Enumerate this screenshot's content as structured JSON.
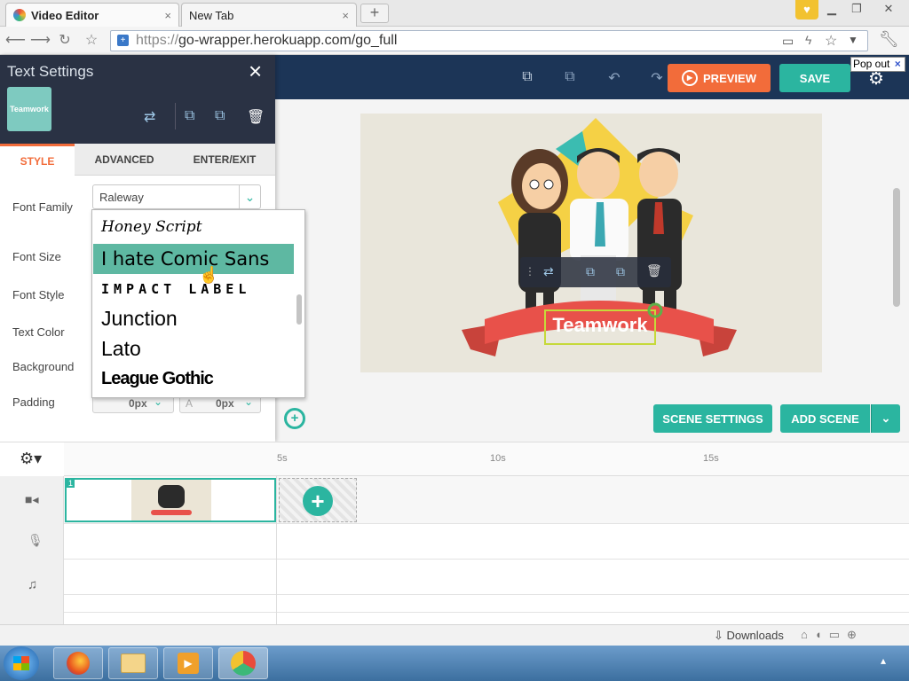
{
  "browser": {
    "tabs": [
      {
        "label": "Video Editor",
        "close": "×"
      },
      {
        "label": "New Tab",
        "close": "×"
      }
    ],
    "new_tab_symbol": "+",
    "url_scheme": "https://",
    "url_rest": "go-wrapper.herokuapp.com/go_full",
    "popout_label": "Pop out",
    "popout_close": "×"
  },
  "header": {
    "preview_label": "PREVIEW",
    "save_label": "SAVE"
  },
  "panel": {
    "title": "Text Settings",
    "close": "×",
    "thumbnail_text": "Teamwork",
    "tabs": [
      "STYLE",
      "ADVANCED",
      "ENTER/EXIT"
    ],
    "labels": {
      "font_family": "Font Family",
      "font_size": "Font Size",
      "font_style": "Font Style",
      "text_color": "Text Color",
      "background": "Background",
      "padding": "Padding"
    },
    "font_family_value": "Raleway",
    "padding_left_value": "0px",
    "padding_right_value": "0px"
  },
  "font_dropdown": {
    "items": [
      "Honey Script",
      "I hate Comic Sans",
      "IMPACT LABEL",
      "Junction",
      "Lato",
      "League Gothic"
    ],
    "highlighted_index": 1
  },
  "stage": {
    "banner_text": "Teamwork"
  },
  "actions": {
    "scene_settings": "SCENE SETTINGS",
    "add_scene": "ADD SCENE"
  },
  "timeline": {
    "ticks": [
      "5s",
      "10s",
      "15s"
    ],
    "clip_number": "1"
  },
  "status": {
    "downloads": "Downloads"
  },
  "colors": {
    "accent_orange": "#f26c3a",
    "accent_teal": "#2bb5a0",
    "header_navy": "#1c3557",
    "panel_dark": "#2a3244"
  }
}
